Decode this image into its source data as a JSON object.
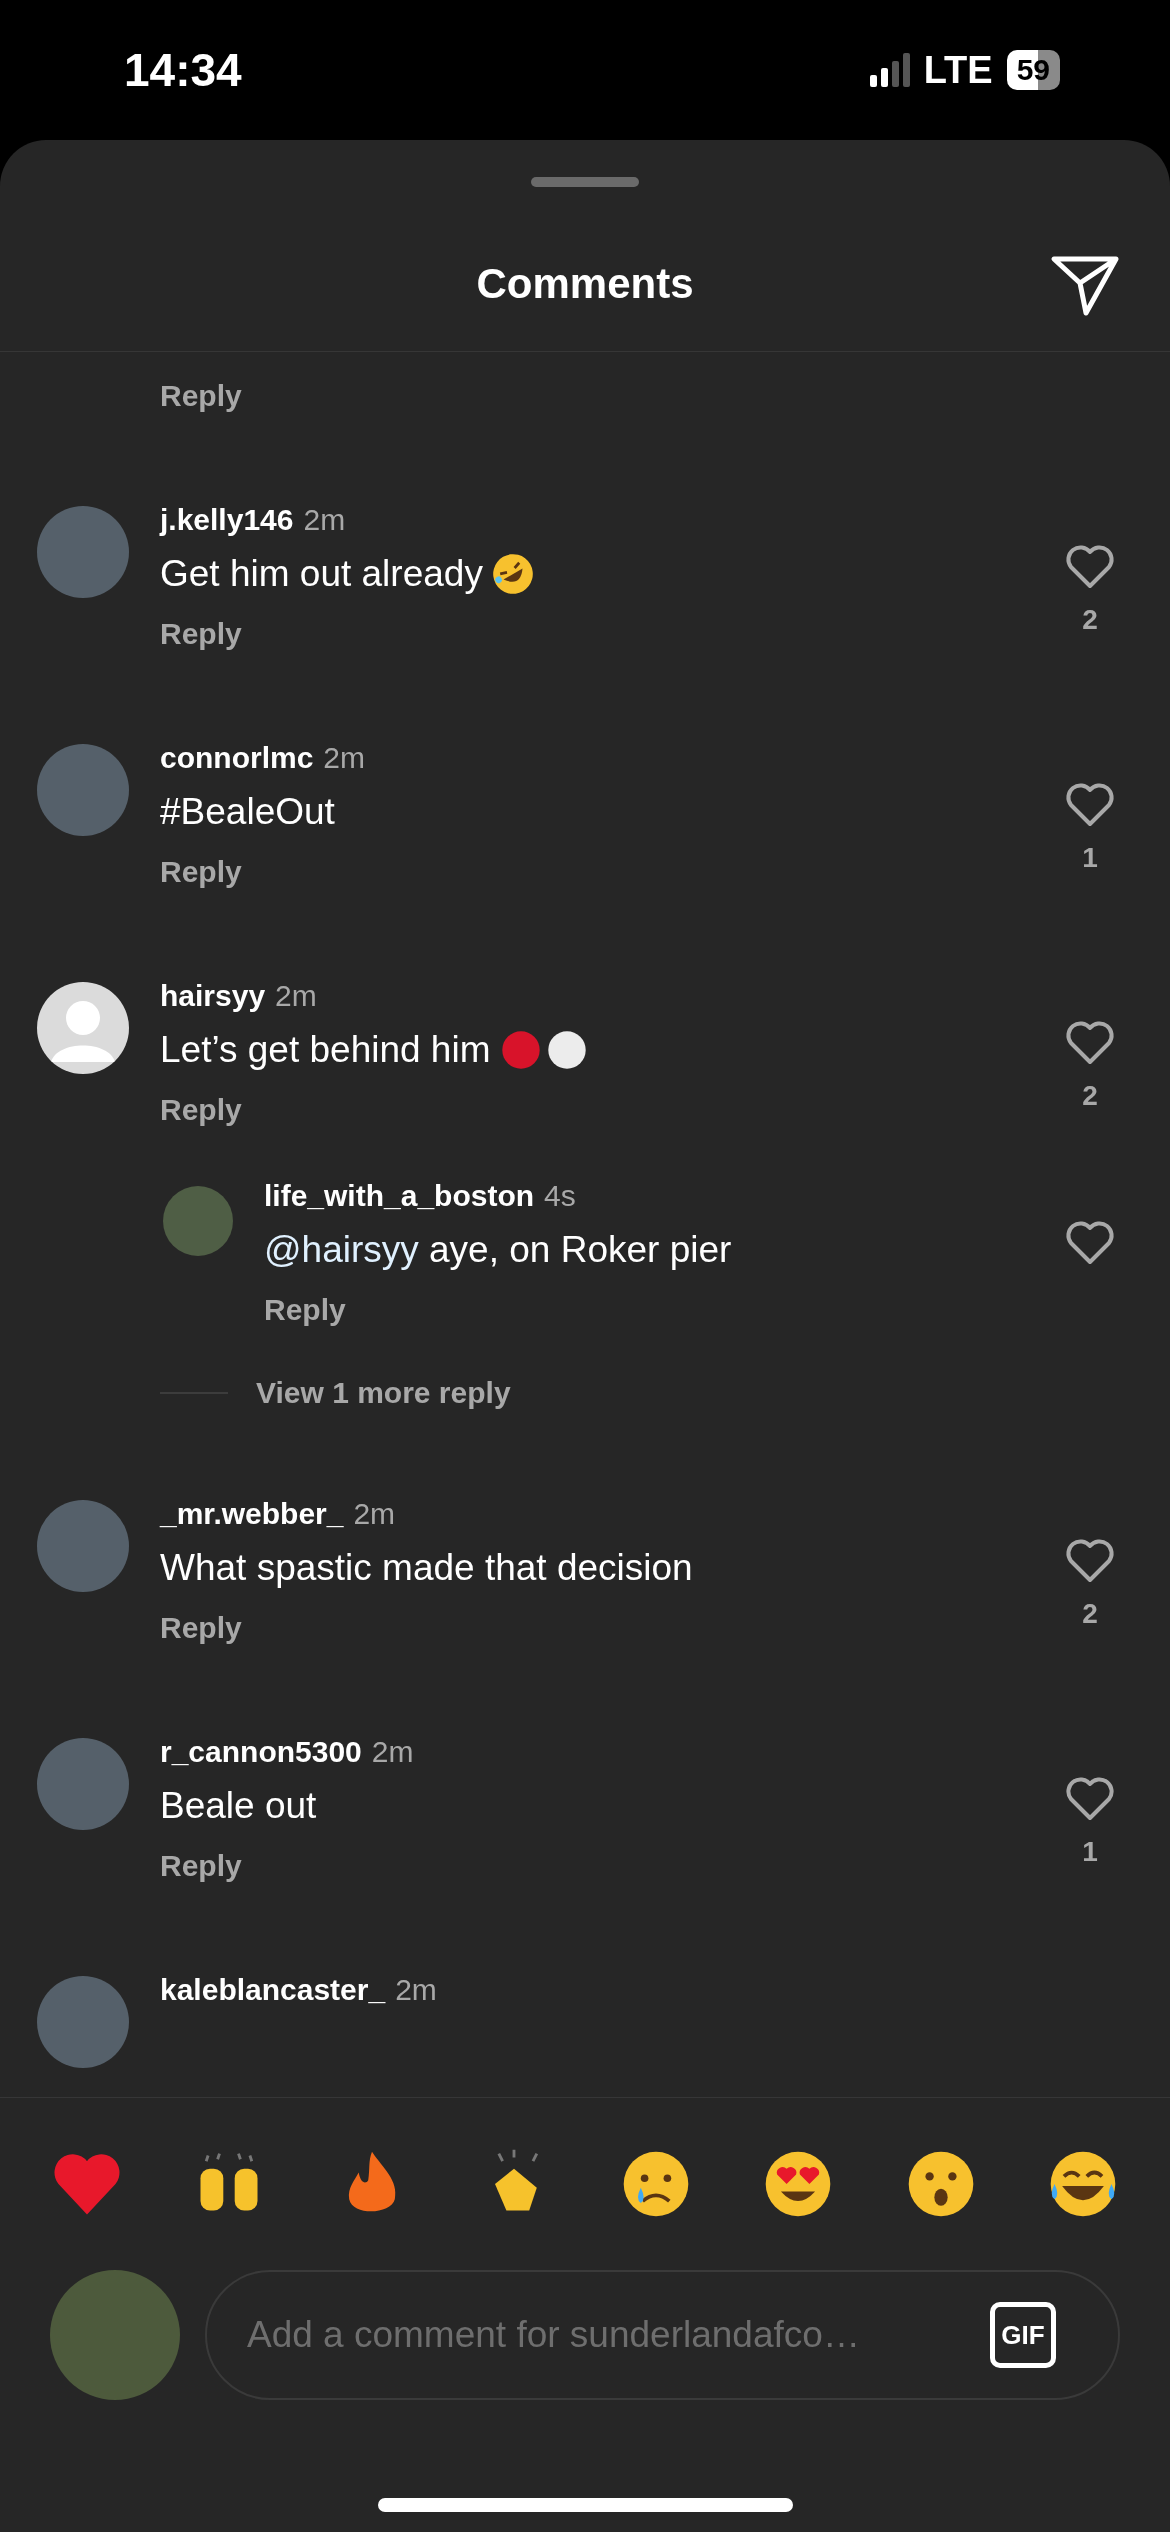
{
  "status_bar": {
    "time": "14:34",
    "network": "LTE",
    "battery": "59"
  },
  "sheet": {
    "title": "Comments"
  },
  "comments": [
    {
      "kind": "partial",
      "reply_label": "Reply"
    },
    {
      "kind": "comment",
      "avatar": {
        "kind": "photo"
      },
      "username": "j.kelly146",
      "time": "2m",
      "text": "Get him out already",
      "emojis": [
        {
          "kind": "rofl"
        }
      ],
      "reply_label": "Reply",
      "likes": "2"
    },
    {
      "kind": "comment",
      "avatar": {
        "kind": "photo"
      },
      "username": "connorlmc",
      "time": "2m",
      "text": "#BealeOut",
      "reply_label": "Reply",
      "likes": "1"
    },
    {
      "kind": "comment",
      "avatar": {
        "kind": "default"
      },
      "username": "hairsyy",
      "time": "2m",
      "text": "Let’s get behind him",
      "emojis": [
        {
          "kind": "red-circle"
        },
        {
          "kind": "white-circle"
        }
      ],
      "reply_label": "Reply",
      "likes": "2",
      "replies": [
        {
          "avatar": {
            "kind": "photo"
          },
          "username": "life_with_a_boston",
          "time": "4s",
          "mention": "@hairsyy",
          "text": "aye, on Roker pier",
          "reply_label": "Reply"
        }
      ],
      "view_more": "View 1 more reply"
    },
    {
      "kind": "comment",
      "avatar": {
        "kind": "photo"
      },
      "username": "_mr.webber_",
      "time": "2m",
      "text": "What spastic made that decision",
      "reply_label": "Reply",
      "likes": "2"
    },
    {
      "kind": "comment",
      "avatar": {
        "kind": "photo"
      },
      "username": "r_cannon5300",
      "time": "2m",
      "text": "Beale out",
      "reply_label": "Reply",
      "likes": "1"
    },
    {
      "kind": "cutoff",
      "avatar": {
        "kind": "photo"
      },
      "username": "kaleblancaster_",
      "time": "2m"
    }
  ],
  "comment_input": {
    "placeholder": "Add a comment for sunderlandafco…",
    "gif_label": "GIF"
  }
}
